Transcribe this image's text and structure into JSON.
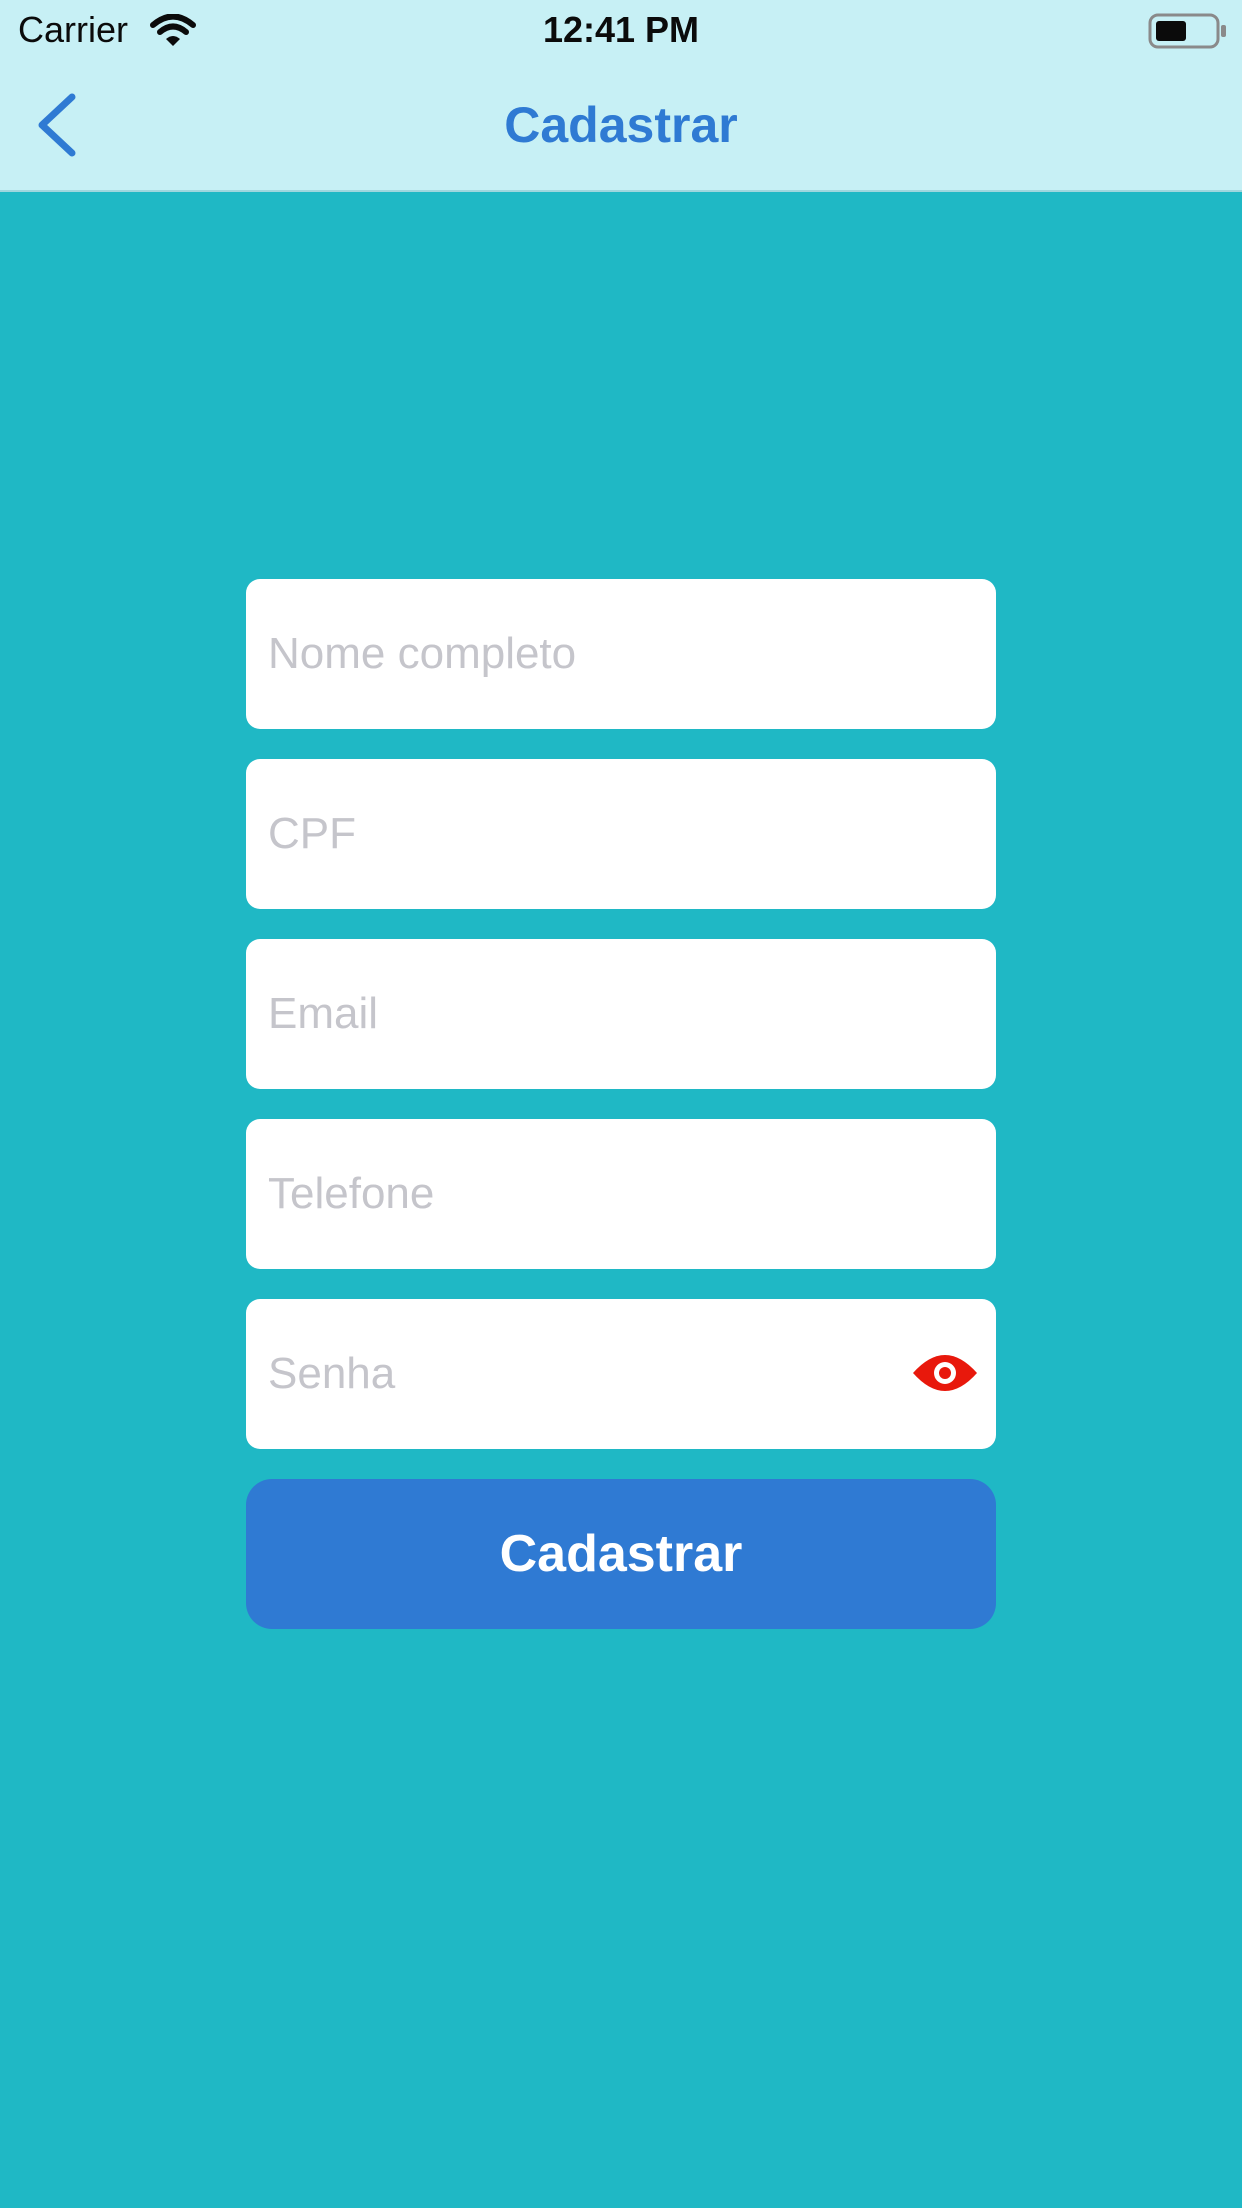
{
  "status_bar": {
    "carrier": "Carrier",
    "time": "12:41 PM",
    "wifi_icon": "wifi-icon",
    "battery_icon": "battery-icon"
  },
  "nav": {
    "title": "Cadastrar",
    "back_icon": "chevron-left-icon",
    "accent_color": "#2f7ad3",
    "bar_color": "#c7f0f5"
  },
  "form": {
    "fields": [
      {
        "placeholder": "Nome completo",
        "value": ""
      },
      {
        "placeholder": "CPF",
        "value": ""
      },
      {
        "placeholder": "Email",
        "value": ""
      },
      {
        "placeholder": "Telefone",
        "value": ""
      },
      {
        "placeholder": "Senha",
        "value": "",
        "toggle_icon": "eye-icon"
      }
    ],
    "submit_label": "Cadastrar"
  },
  "colors": {
    "background": "#1fb8c5",
    "field_background": "#ffffff",
    "placeholder": "#c5c5cb",
    "button": "#2f7ad3",
    "eye_icon": "#e8180c"
  }
}
